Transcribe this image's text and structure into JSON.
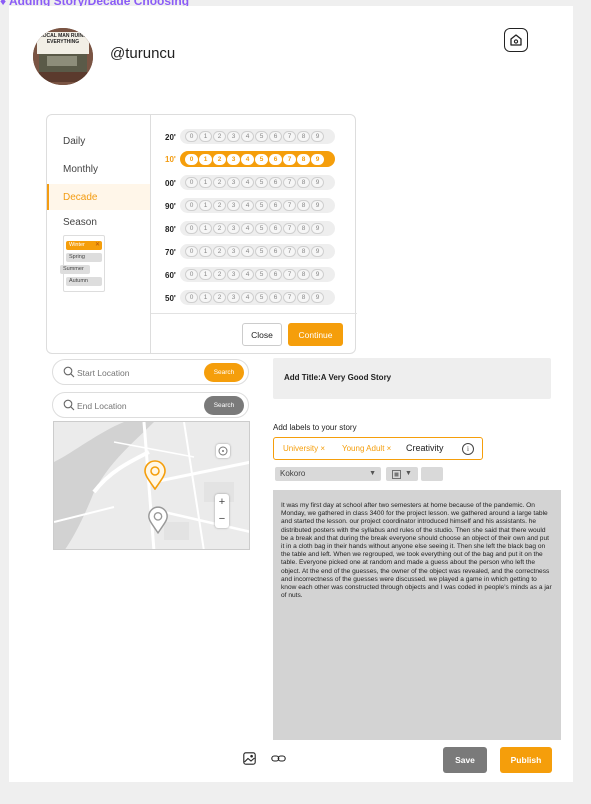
{
  "frame_label": "♦ Adding Story/Decade Choosing",
  "profile": {
    "username": "@turuncu",
    "avatar_caption": "LOCAL MAN RUINS EVERYTHING"
  },
  "picker": {
    "modes": [
      "Daily",
      "Monthly",
      "Decade",
      "Season"
    ],
    "active_mode": "Decade",
    "seasons": [
      "Winter",
      "Spring",
      "Summer",
      "Autumn"
    ],
    "active_season": "Winter",
    "decades": [
      "20'",
      "10'",
      "00'",
      "90'",
      "80'",
      "70'",
      "60'",
      "50'"
    ],
    "active_decade": "10'",
    "digits": [
      "0",
      "1",
      "2",
      "3",
      "4",
      "5",
      "6",
      "7",
      "8",
      "9"
    ],
    "close_label": "Close",
    "continue_label": "Continue"
  },
  "start_location": {
    "placeholder": "Start Location",
    "button": "Search"
  },
  "end_location": {
    "placeholder": "End Location",
    "button": "Search"
  },
  "title_field": {
    "label": "Add Title:A Very Good Story"
  },
  "labels": {
    "header": "Add labels to your story",
    "tags": [
      "University",
      "Young Adult"
    ],
    "input_value": "Creativity"
  },
  "editor": {
    "font": "Kokoro",
    "format_icon": "format-icon",
    "story_text": "It was my first day at school after two semesters at home because of the pandemic. On Monday, we gathered in class 3400 for the project lesson. we gathered around a large table and started the lesson. our project coordinator introduced himself and his assistants. he distributed posters with the syllabus and rules of the studio. Then she said that there would be a break and that during the break everyone should choose an object of their own and put it in a cloth bag in their hands without anyone else seeing it. Then she left the black bag on the table and left. When we regrouped, we took everything out of the bag and put it on the table. Everyone picked one at random and made a guess about the person who left the object. At the end of the guesses, the owner of the object was revealed, and the correctness and incorrectness of the guesses were discussed. we played a game in which getting to know each other was constructed through objects and I was coded in people's minds as a jar of nuts."
  },
  "actions": {
    "save": "Save",
    "publish": "Publish"
  },
  "colors": {
    "accent": "#f59e0b",
    "frame_label": "#8b5cf6",
    "save": "#7a7a7a"
  }
}
